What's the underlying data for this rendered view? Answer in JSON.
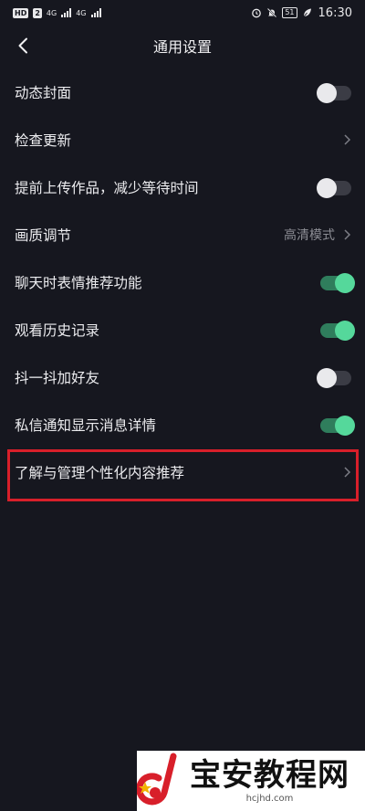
{
  "status_bar": {
    "network_badges": [
      "HD",
      "2",
      "4G",
      "4G"
    ],
    "battery": "51",
    "time": "16:30"
  },
  "header": {
    "title": "通用设置",
    "back_icon": "chevron-left-icon"
  },
  "settings": [
    {
      "label": "动态封面",
      "control": "toggle",
      "on": false
    },
    {
      "label": "检查更新",
      "control": "chevron"
    },
    {
      "label": "提前上传作品，减少等待时间",
      "control": "toggle",
      "on": false
    },
    {
      "label": "画质调节",
      "control": "chevron",
      "value": "高清模式"
    },
    {
      "label": "聊天时表情推荐功能",
      "control": "toggle",
      "on": true
    },
    {
      "label": "观看历史记录",
      "control": "toggle",
      "on": true
    },
    {
      "label": "抖一抖加好友",
      "control": "toggle",
      "on": false
    },
    {
      "label": "私信通知显示消息详情",
      "control": "toggle",
      "on": true
    },
    {
      "label": "了解与管理个性化内容推荐",
      "control": "chevron",
      "highlighted": true
    }
  ],
  "colors": {
    "background": "#16171f",
    "toggle_on": "#55d89b",
    "highlight_border": "#d81f2a"
  },
  "watermark": {
    "main": "宝安教程网",
    "sub": "hcjhd.com"
  }
}
